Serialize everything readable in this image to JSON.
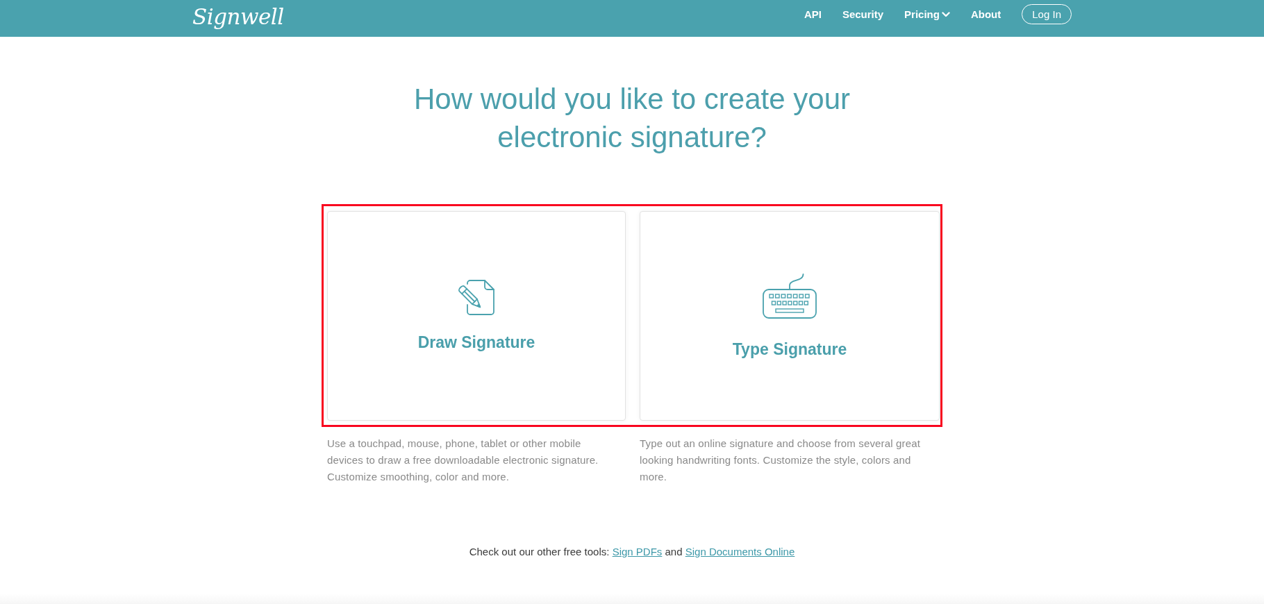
{
  "header": {
    "logo": "Signwell",
    "nav": [
      {
        "label": "API",
        "kind": "link"
      },
      {
        "label": "Security",
        "kind": "link"
      },
      {
        "label": "Pricing",
        "kind": "dropdown"
      },
      {
        "label": "About",
        "kind": "link"
      },
      {
        "label": "Log In",
        "kind": "button"
      }
    ]
  },
  "heading": "How would you like to create your electronic signature?",
  "options": [
    {
      "kind": "draw",
      "title": "Draw Signature",
      "description": "Use a touchpad, mouse, phone, tablet or other mobile devices to draw a free downloadable electronic signature. Customize smoothing, color and more."
    },
    {
      "kind": "type",
      "title": "Type Signature",
      "description": "Type out an online signature and choose from several great looking handwriting fonts. Customize the style, colors and more."
    }
  ],
  "other_tools": {
    "lead": "Check out our other free tools:",
    "links": [
      "Sign PDFs",
      "Sign Documents Online"
    ],
    "conjunction": "and"
  }
}
